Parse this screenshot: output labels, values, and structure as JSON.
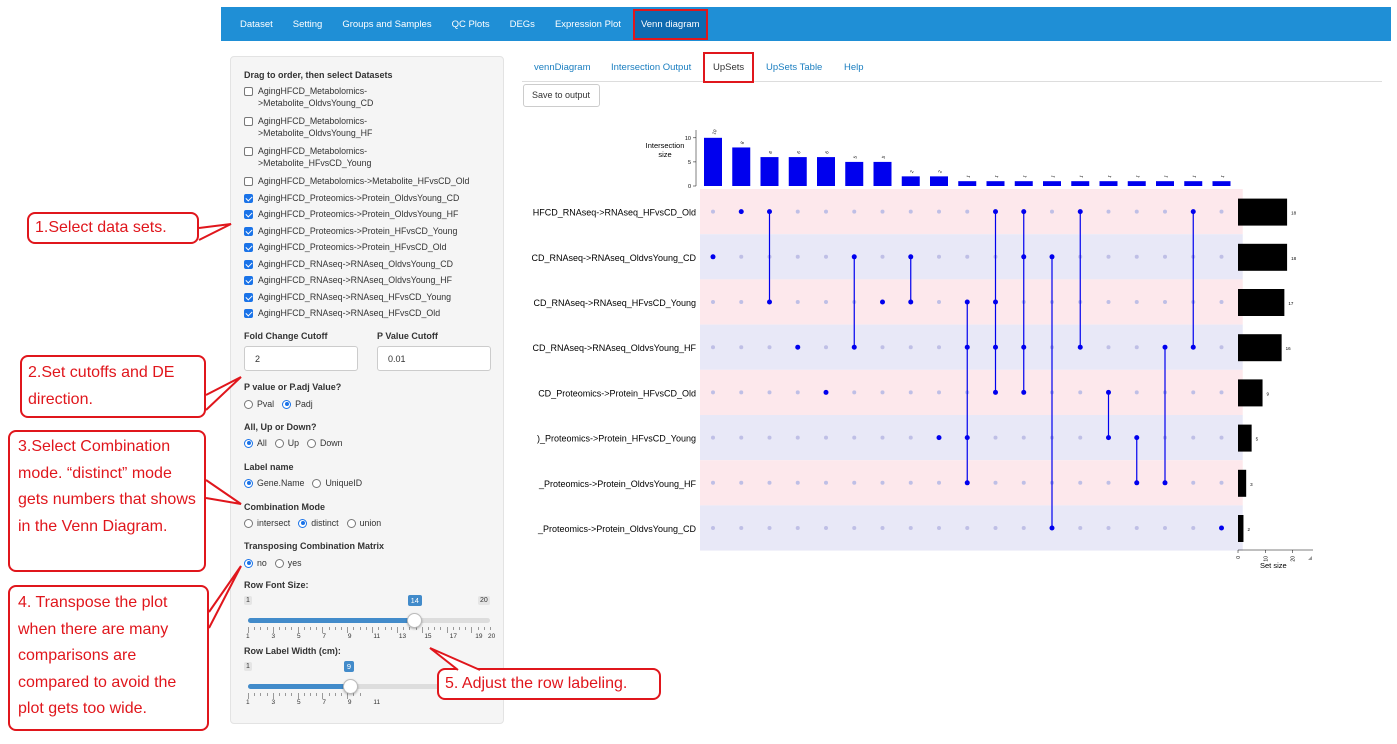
{
  "nav": {
    "items": [
      "Dataset",
      "Setting",
      "Groups and Samples",
      "QC Plots",
      "DEGs",
      "Expression Plot",
      "Venn diagram"
    ],
    "active": "Venn diagram"
  },
  "sidebar": {
    "datasets_label": "Drag to order, then select Datasets",
    "datasets": [
      {
        "label": "AgingHFCD_Metabolomics-\n>Metabolite_OldvsYoung_CD",
        "checked": false
      },
      {
        "label": "AgingHFCD_Metabolomics-\n>Metabolite_OldvsYoung_HF",
        "checked": false
      },
      {
        "label": "AgingHFCD_Metabolomics-\n>Metabolite_HFvsCD_Young",
        "checked": false
      },
      {
        "label": "AgingHFCD_Metabolomics->Metabolite_HFvsCD_Old",
        "checked": false
      },
      {
        "label": "AgingHFCD_Proteomics->Protein_OldvsYoung_CD",
        "checked": true
      },
      {
        "label": "AgingHFCD_Proteomics->Protein_OldvsYoung_HF",
        "checked": true
      },
      {
        "label": "AgingHFCD_Proteomics->Protein_HFvsCD_Young",
        "checked": true
      },
      {
        "label": "AgingHFCD_Proteomics->Protein_HFvsCD_Old",
        "checked": true
      },
      {
        "label": "AgingHFCD_RNAseq->RNAseq_OldvsYoung_CD",
        "checked": true
      },
      {
        "label": "AgingHFCD_RNAseq->RNAseq_OldvsYoung_HF",
        "checked": true
      },
      {
        "label": "AgingHFCD_RNAseq->RNAseq_HFvsCD_Young",
        "checked": true
      },
      {
        "label": "AgingHFCD_RNAseq->RNAseq_HFvsCD_Old",
        "checked": true
      }
    ],
    "fc_label": "Fold Change Cutoff",
    "fc_value": "2",
    "p_label": "P Value Cutoff",
    "p_value": "0.01",
    "padj_label": "P value or P.adj Value?",
    "padj_options": [
      "Pval",
      "Padj"
    ],
    "padj_selected": "Padj",
    "dir_label": "All, Up or Down?",
    "dir_options": [
      "All",
      "Up",
      "Down"
    ],
    "dir_selected": "All",
    "labelname_label": "Label name",
    "labelname_options": [
      "Gene.Name",
      "UniqueID"
    ],
    "labelname_selected": "Gene.Name",
    "combo_label": "Combination Mode",
    "combo_options": [
      "intersect",
      "distinct",
      "union"
    ],
    "combo_selected": "distinct",
    "transpose_label": "Transposing Combination Matrix",
    "transpose_options": [
      "no",
      "yes"
    ],
    "transpose_selected": "no",
    "rowfont_label": "Row Font Size:",
    "rowfont_slider": {
      "min": 1,
      "max": 20,
      "value": 14,
      "ticks": [
        "1",
        "3",
        "5",
        "7",
        "9",
        "11",
        "13",
        "15",
        "17",
        "19",
        "20"
      ]
    },
    "rowwidth_label": "Row Label Width (cm):",
    "rowwidth_slider": {
      "min": 1,
      "max": 20,
      "value": 9,
      "min_label": "1",
      "ticks": [
        "1",
        "3",
        "5",
        "7",
        "9",
        "11"
      ]
    }
  },
  "tabs": {
    "items": [
      "vennDiagram",
      "Intersection Output",
      "UpSets",
      "UpSets Table",
      "Help"
    ],
    "active": "UpSets"
  },
  "save_button": "Save to output",
  "callouts": {
    "c1": "1.Select data sets.",
    "c2": "2.Set cutoffs and DE direction.",
    "c3": "3.Select Combination mode. “distinct” mode gets numbers that shows in the Venn Diagram.",
    "c4": "4. Transpose the plot when there are many comparisons are compared to avoid the plot gets too wide.",
    "c5": "5. Adjust the row labeling."
  },
  "chart_data": {
    "type": "upset",
    "sets": [
      "HFCD_RNAseq->RNAseq_HFvsCD_Old",
      "CD_RNAseq->RNAseq_OldvsYoung_CD",
      "CD_RNAseq->RNAseq_HFvsCD_Young",
      "CD_RNAseq->RNAseq_OldvsYoung_HF",
      "CD_Proteomics->Protein_HFvsCD_Old",
      ")_Proteomics->Protein_HFvsCD_Young",
      "_Proteomics->Protein_OldvsYoung_HF",
      "_Proteomics->Protein_OldvsYoung_CD"
    ],
    "set_sizes": [
      18,
      18,
      17,
      16,
      9,
      5,
      3,
      2
    ],
    "set_size_labels": [
      "18",
      "18",
      "17",
      "16",
      "9",
      "5",
      "3",
      "2"
    ],
    "intersection_sizes": [
      10,
      8,
      6,
      6,
      6,
      5,
      5,
      2,
      2,
      1,
      1,
      1,
      1,
      1,
      1,
      1,
      1,
      1,
      1
    ],
    "intersection_labels": [
      "10",
      "8",
      "6",
      "6",
      "6",
      "5",
      "5",
      "2",
      "2",
      "1",
      "1",
      "1",
      "1",
      "1",
      "1",
      "1",
      "1",
      "1",
      "1"
    ],
    "combinations": [
      [
        1
      ],
      [
        0
      ],
      [
        0,
        2
      ],
      [
        3
      ],
      [
        4
      ],
      [
        1,
        3
      ],
      [
        2
      ],
      [
        1,
        2
      ],
      [
        5
      ],
      [
        2,
        3,
        5,
        6
      ],
      [
        0,
        2,
        3,
        4
      ],
      [
        0,
        1,
        3,
        4
      ],
      [
        1,
        7
      ],
      [
        0,
        3
      ],
      [
        4,
        5
      ],
      [
        5,
        6
      ],
      [
        3,
        6
      ],
      [
        0,
        3
      ],
      [
        7
      ]
    ],
    "ylabel": "Intersection\nsize",
    "y_ticks": [
      "0",
      "5",
      "10"
    ],
    "ylim": [
      0,
      11
    ],
    "xlabel_sets": "Set size",
    "x_ticks_sets": [
      "0",
      "10",
      "20"
    ],
    "bar_color": "#0000ee",
    "set_bar_color": "#000000"
  }
}
